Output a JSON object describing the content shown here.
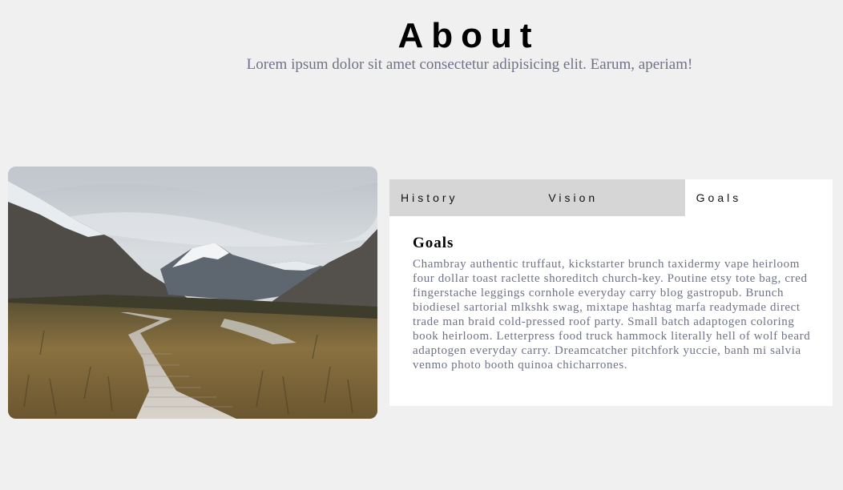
{
  "about": {
    "title": "About",
    "subtitle": "Lorem ipsum dolor sit amet consectetur adipisicing elit. Earum, aperiam!"
  },
  "photo": {
    "description_icon": "landscape-photo"
  },
  "tabs": [
    {
      "label": "History",
      "active": false
    },
    {
      "label": "Vision",
      "active": false
    },
    {
      "label": "Goals",
      "active": true
    }
  ],
  "panel": {
    "heading": "Goals",
    "body": "Chambray authentic truffaut, kickstarter brunch taxidermy vape heirloom four dollar toast raclette shoreditch church-key. Poutine etsy tote bag, cred fingerstache leggings cornhole everyday carry blog gastropub. Brunch biodiesel sartorial mlkshk swag, mixtape hashtag marfa readymade direct trade man braid cold-pressed roof party. Small batch adaptogen coloring book heirloom. Letterpress food truck hammock literally hell of wolf beard adaptogen everyday carry. Dreamcatcher pitchfork yuccie, banh mi salvia venmo photo booth quinoa chicharrones."
  },
  "colors": {
    "background": "#f0f0f0",
    "tab_inactive": "#d6d6d6",
    "tab_active": "#ffffff",
    "muted_text": "#6e7387"
  }
}
